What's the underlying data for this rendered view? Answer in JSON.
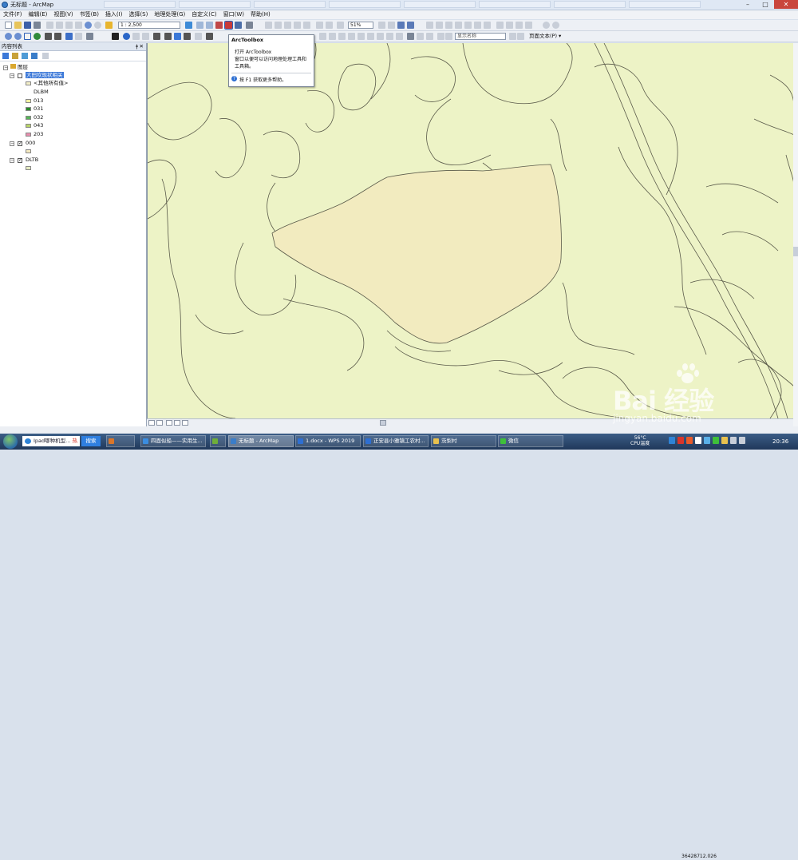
{
  "window": {
    "title": "无标题 - ArcMap",
    "buttons": {
      "minimize": "–",
      "maximize": "□",
      "close": "✕"
    }
  },
  "menu": {
    "items": [
      "文件(F)",
      "编辑(E)",
      "视图(V)",
      "书签(B)",
      "插入(I)",
      "选择(S)",
      "地理处理(G)",
      "自定义(C)",
      "窗口(W)",
      "帮助(H)"
    ]
  },
  "toolbar": {
    "scale": "1 : 2,500",
    "zoom_percent": "51%",
    "display_name_box": "显示名称",
    "layout_text": "页面文本(P) ▾"
  },
  "tooltip": {
    "title": "ArcToolbox",
    "line1": "打开 ArcToolbox",
    "line2": "窗口以便可以访问地理处理工具和",
    "line3": "工具箱。",
    "help": "按 F1 获取更多帮助。"
  },
  "toc": {
    "header": "内容列表",
    "pin": "ǂ",
    "close": "✕",
    "root": "图层",
    "layer1": {
      "name": "大田坎现状相关",
      "other_values": "<其他所有值>",
      "field": "DLBM",
      "classes": [
        {
          "label": "013",
          "color": "#f4f3a3"
        },
        {
          "label": "031",
          "color": "#2d8a2e"
        },
        {
          "label": "032",
          "color": "#58b45a"
        },
        {
          "label": "043",
          "color": "#b8d36a"
        },
        {
          "label": "203",
          "color": "#e78fae"
        }
      ]
    },
    "layer2": {
      "name": "000",
      "color": "#f3e8c0"
    },
    "layer3": {
      "name": "DLTB",
      "color": "#e6ecc2"
    }
  },
  "map": {
    "background": "#edf3c6",
    "parcel_fill": "#f2ebbf",
    "line_color": "#5a5a4a"
  },
  "statusbar": {
    "coordinates": "36428712.026"
  },
  "taskbar": {
    "search_text": "Ipad哪种机型...",
    "search_hot": "热",
    "search_button": "搜索",
    "items": [
      {
        "label": ""
      },
      {
        "label": "四面似船——实用生..."
      },
      {
        "label": ""
      },
      {
        "label": "无标题 - ArcMap"
      },
      {
        "label": "1.docx - WPS 2019"
      },
      {
        "label": "正安县小雅镇工农村..."
      },
      {
        "label": "茨梨村"
      },
      {
        "label": "微信"
      }
    ],
    "temp": "56°C",
    "temp_label": "CPU温度",
    "time": "20:36"
  },
  "watermark": {
    "brand": "Bai 经验",
    "url": "jingyan.baidu.com"
  }
}
